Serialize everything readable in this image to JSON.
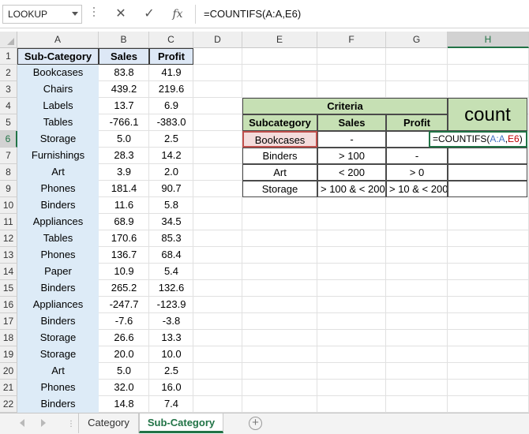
{
  "formula_bar": {
    "name_box": "LOOKUP",
    "cancel_icon": "✕",
    "enter_icon": "✓",
    "fx_label": "fx",
    "formula": "=COUNTIFS(A:A,E6)"
  },
  "columns": [
    "A",
    "B",
    "C",
    "D",
    "E",
    "F",
    "G",
    "H"
  ],
  "rows": [
    "1",
    "2",
    "3",
    "4",
    "5",
    "6",
    "7",
    "8",
    "9",
    "10",
    "11",
    "12",
    "13",
    "14",
    "15",
    "16",
    "17",
    "18",
    "19",
    "20",
    "21",
    "22"
  ],
  "data_table": {
    "headers": [
      "Sub-Category",
      "Sales",
      "Profit"
    ],
    "rows": [
      [
        "Bookcases",
        "83.8",
        "41.9"
      ],
      [
        "Chairs",
        "439.2",
        "219.6"
      ],
      [
        "Labels",
        "13.7",
        "6.9"
      ],
      [
        "Tables",
        "-766.1",
        "-383.0"
      ],
      [
        "Storage",
        "5.0",
        "2.5"
      ],
      [
        "Furnishings",
        "28.3",
        "14.2"
      ],
      [
        "Art",
        "3.9",
        "2.0"
      ],
      [
        "Phones",
        "181.4",
        "90.7"
      ],
      [
        "Binders",
        "11.6",
        "5.8"
      ],
      [
        "Appliances",
        "68.9",
        "34.5"
      ],
      [
        "Tables",
        "170.6",
        "85.3"
      ],
      [
        "Phones",
        "136.7",
        "68.4"
      ],
      [
        "Paper",
        "10.9",
        "5.4"
      ],
      [
        "Binders",
        "265.2",
        "132.6"
      ],
      [
        "Appliances",
        "-247.7",
        "-123.9"
      ],
      [
        "Binders",
        "-7.6",
        "-3.8"
      ],
      [
        "Storage",
        "26.6",
        "13.3"
      ],
      [
        "Storage",
        "20.0",
        "10.0"
      ],
      [
        "Art",
        "5.0",
        "2.5"
      ],
      [
        "Phones",
        "32.0",
        "16.0"
      ],
      [
        "Binders",
        "14.8",
        "7.4"
      ]
    ]
  },
  "criteria": {
    "title": "Criteria",
    "count_label": "count",
    "headers": [
      "Subcategory",
      "Sales",
      "Profit"
    ],
    "rows": [
      [
        "Bookcases",
        "-",
        ""
      ],
      [
        "Binders",
        "> 100",
        "-"
      ],
      [
        "Art",
        "< 200",
        "> 0"
      ],
      [
        "Storage",
        "> 100 & < 200",
        "> 10 & < 200"
      ]
    ],
    "edit_formula": {
      "prefix": "=COUNTIFS(",
      "arg1": "A:A",
      "comma": ",",
      "arg2": "E6",
      "suffix": ")"
    }
  },
  "sheets": {
    "tabs": [
      "Category",
      "Sub-Category"
    ],
    "active": "Sub-Category",
    "add_icon": "+"
  },
  "colors": {
    "accent": "#217346",
    "criteria_header": "#c6e0b4",
    "data_column": "#ddebf7",
    "selected_cell": "#c0504d"
  }
}
